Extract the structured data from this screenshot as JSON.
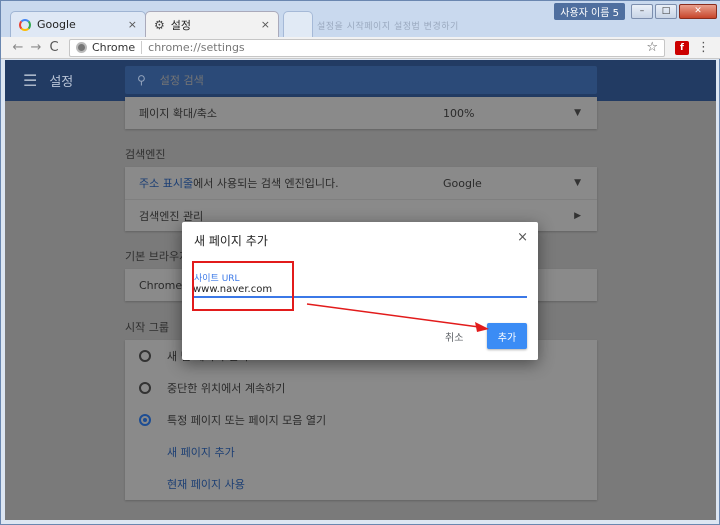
{
  "window": {
    "user_label": "사용자 이름 5",
    "min": "–",
    "max": "□",
    "close": "✕"
  },
  "tabs": [
    {
      "title": "Google",
      "close": "×"
    },
    {
      "title": "설정",
      "close": "×"
    },
    {
      "title": "",
      "blurred_text": "설정을 시작페이지 설정법 변경하기"
    }
  ],
  "toolbar": {
    "back": "←",
    "forward": "→",
    "reload": "C",
    "chip": "Chrome",
    "url": "chrome://settings",
    "star": "☆",
    "menu": "⋮"
  },
  "appbar": {
    "menu_icon": "☰",
    "title": "설정",
    "search_placeholder": "설정 검색"
  },
  "appearance": {
    "zoom_label": "페이지 확대/축소",
    "zoom_value": "100%"
  },
  "search_engine": {
    "section": "검색엔진",
    "address_bar_link": "주소 표시줄",
    "address_bar_rest": "에서 사용되는 검색 엔진입니다.",
    "engine_value": "Google",
    "manage": "검색엔진 관리"
  },
  "default_browser": {
    "section": "기본 브라우저",
    "text": "Chrome이"
  },
  "startup": {
    "section": "시작 그룹",
    "options": [
      {
        "label": "새 탭 페이지 열기",
        "selected": false
      },
      {
        "label": "중단한 위치에서 계속하기",
        "selected": false
      },
      {
        "label": "특정 페이지 또는 페이지 모음 열기",
        "selected": true
      }
    ],
    "add_page": "새 페이지 추가",
    "use_current": "현재 페이지 사용"
  },
  "dialog": {
    "title": "새 페이지 추가",
    "close": "×",
    "field_label": "사이트 URL",
    "field_value": "www.naver.com",
    "cancel": "취소",
    "add": "추가"
  },
  "colors": {
    "accent": "#3b8cf5",
    "annotation": "#e21b1b",
    "appbar": "#223b63"
  }
}
